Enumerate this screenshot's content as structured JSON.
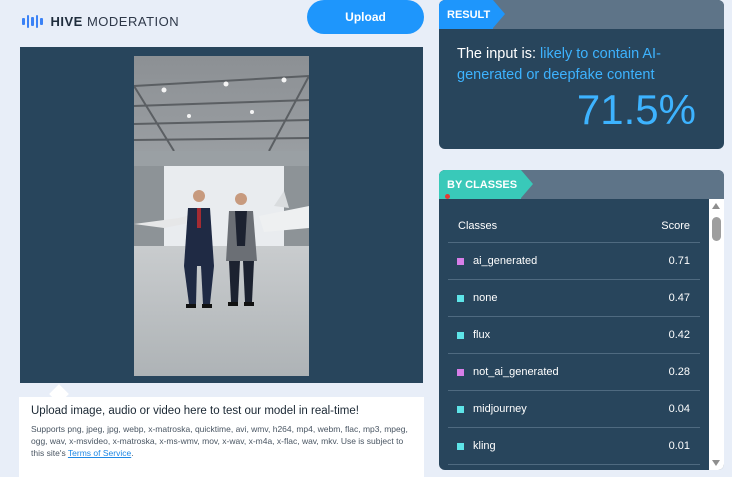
{
  "brand": {
    "name_bold": "HIVE",
    "name_rest": "MODERATION"
  },
  "toolbar": {
    "upload_label": "Upload"
  },
  "upload_info": {
    "title": "Upload image, audio or video here to test our model in real-time!",
    "supports": "Supports png, jpeg, jpg, webp, x-matroska, quicktime, avi, wmv, h264, mp4, webm, flac, mp3, mpeg, ogg, wav, x-msvideo, x-matroska, x-ms-wmv, mov, x-wav, x-m4a, x-flac, wav, mkv. Use is subject to this site's",
    "terms_link": "Terms of Service",
    "terms_after": "."
  },
  "result": {
    "tag": "RESULT",
    "prefix": "The input is: ",
    "verdict": "likely to contain AI-generated or deepfake content",
    "percent": "71.5%"
  },
  "classes": {
    "tag": "BY CLASSES",
    "col_class": "Classes",
    "col_score": "Score",
    "rows": [
      {
        "name": "ai_generated",
        "score": "0.71",
        "color": "#d77ee8"
      },
      {
        "name": "none",
        "score": "0.47",
        "color": "#5ee4e8"
      },
      {
        "name": "flux",
        "score": "0.42",
        "color": "#5ee4e8"
      },
      {
        "name": "not_ai_generated",
        "score": "0.28",
        "color": "#d77ee8"
      },
      {
        "name": "midjourney",
        "score": "0.04",
        "color": "#5ee4e8"
      },
      {
        "name": "kling",
        "score": "0.01",
        "color": "#5ee4e8"
      }
    ]
  },
  "colors": {
    "accent": "#1e96fc",
    "panel": "#28455c",
    "teal": "#39c9b9",
    "highlight": "#3db3ff"
  }
}
